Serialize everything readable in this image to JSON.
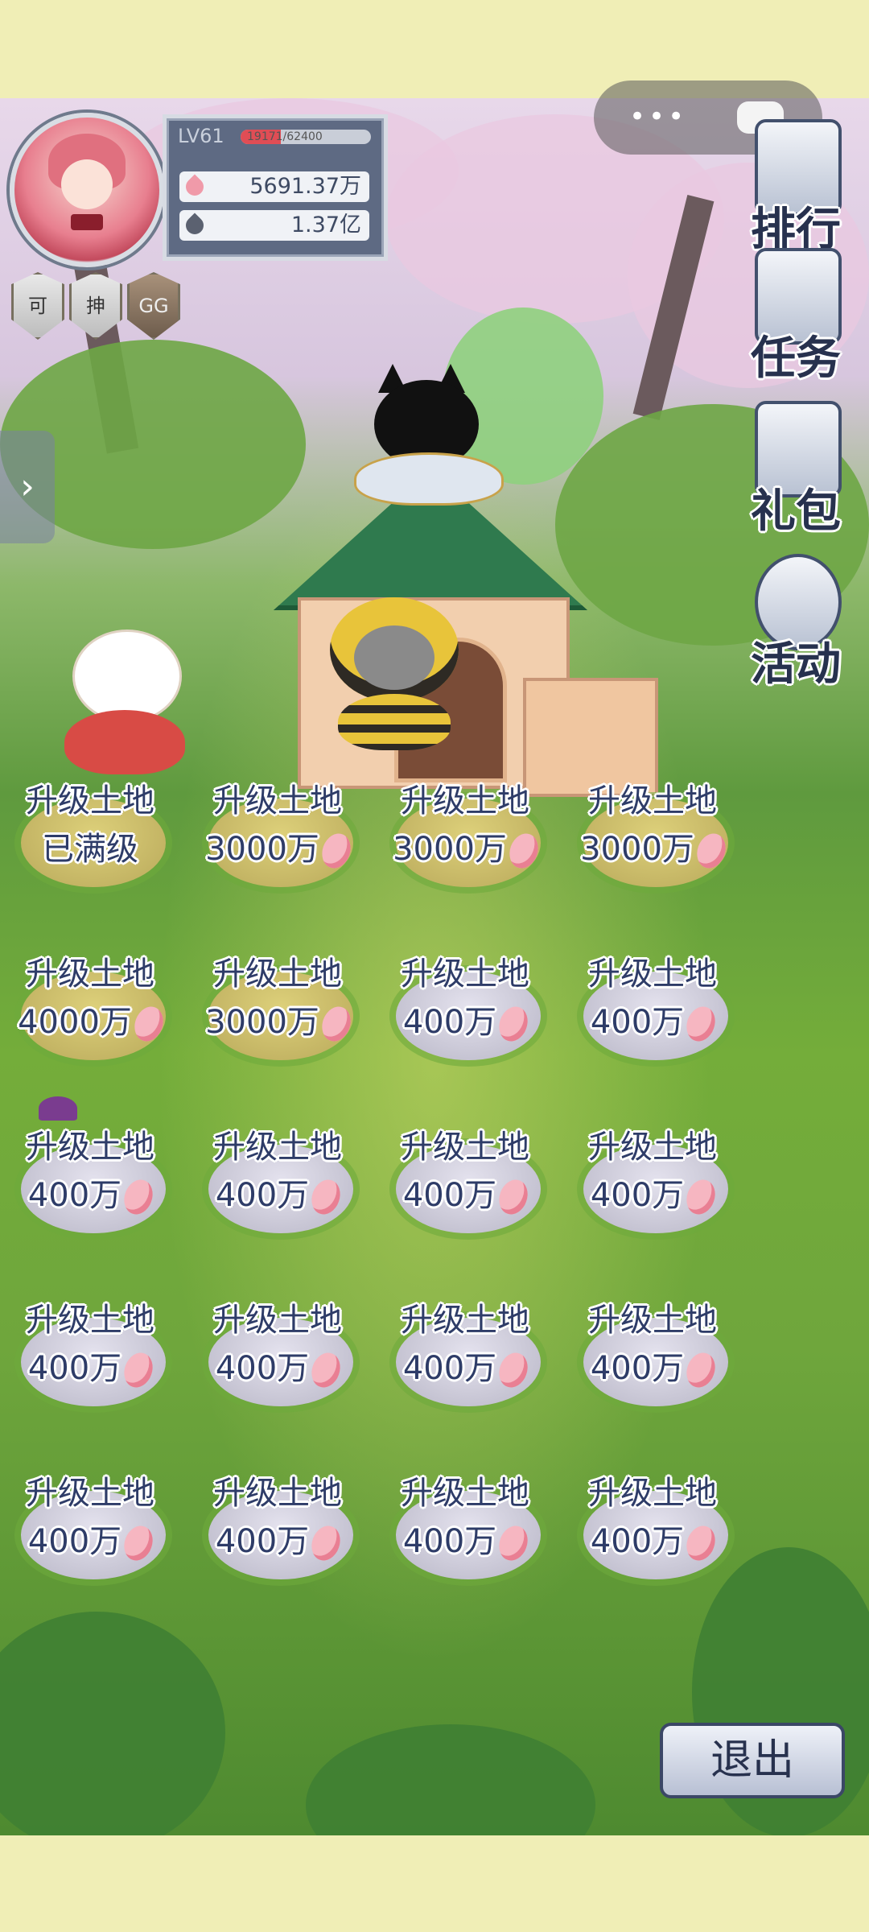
{
  "player": {
    "level": "LV61",
    "exp_text": "19171/62400",
    "exp_fraction": 0.307,
    "hearts": "5691.37万",
    "leaves": "1.37亿"
  },
  "badges": [
    "可",
    "抻",
    "GG"
  ],
  "side_menu": {
    "rank": "排行",
    "tasks": "任务",
    "gift": "礼包",
    "event": "活动"
  },
  "plots": [
    {
      "title": "升级土地",
      "cost": "已满级",
      "type": "gold",
      "heart": false
    },
    {
      "title": "升级土地",
      "cost": "3000万",
      "type": "gold",
      "heart": true
    },
    {
      "title": "升级土地",
      "cost": "3000万",
      "type": "gold",
      "heart": true
    },
    {
      "title": "升级土地",
      "cost": "3000万",
      "type": "gold",
      "heart": true
    },
    {
      "title": "升级土地",
      "cost": "4000万",
      "type": "gold",
      "heart": true
    },
    {
      "title": "升级土地",
      "cost": "3000万",
      "type": "gold",
      "heart": true
    },
    {
      "title": "升级土地",
      "cost": "400万",
      "type": "stone",
      "heart": true
    },
    {
      "title": "升级土地",
      "cost": "400万",
      "type": "stone",
      "heart": true
    },
    {
      "title": "升级土地",
      "cost": "400万",
      "type": "stone",
      "heart": true
    },
    {
      "title": "升级土地",
      "cost": "400万",
      "type": "stone",
      "heart": true
    },
    {
      "title": "升级土地",
      "cost": "400万",
      "type": "stone",
      "heart": true
    },
    {
      "title": "升级土地",
      "cost": "400万",
      "type": "stone",
      "heart": true
    },
    {
      "title": "升级土地",
      "cost": "400万",
      "type": "stone",
      "heart": true
    },
    {
      "title": "升级土地",
      "cost": "400万",
      "type": "stone",
      "heart": true
    },
    {
      "title": "升级土地",
      "cost": "400万",
      "type": "stone",
      "heart": true
    },
    {
      "title": "升级土地",
      "cost": "400万",
      "type": "stone",
      "heart": true
    },
    {
      "title": "升级土地",
      "cost": "400万",
      "type": "stone",
      "heart": true
    },
    {
      "title": "升级土地",
      "cost": "400万",
      "type": "stone",
      "heart": true
    },
    {
      "title": "升级土地",
      "cost": "400万",
      "type": "stone",
      "heart": true
    },
    {
      "title": "升级土地",
      "cost": "400万",
      "type": "stone",
      "heart": true
    }
  ],
  "exit_label": "退出",
  "colors": {
    "frame": "#f0eeb6",
    "label_text": "#2e3c68",
    "accent_heart": "#f6b6c1"
  },
  "icons": {
    "menu_dots": "•••",
    "expand": "›"
  }
}
